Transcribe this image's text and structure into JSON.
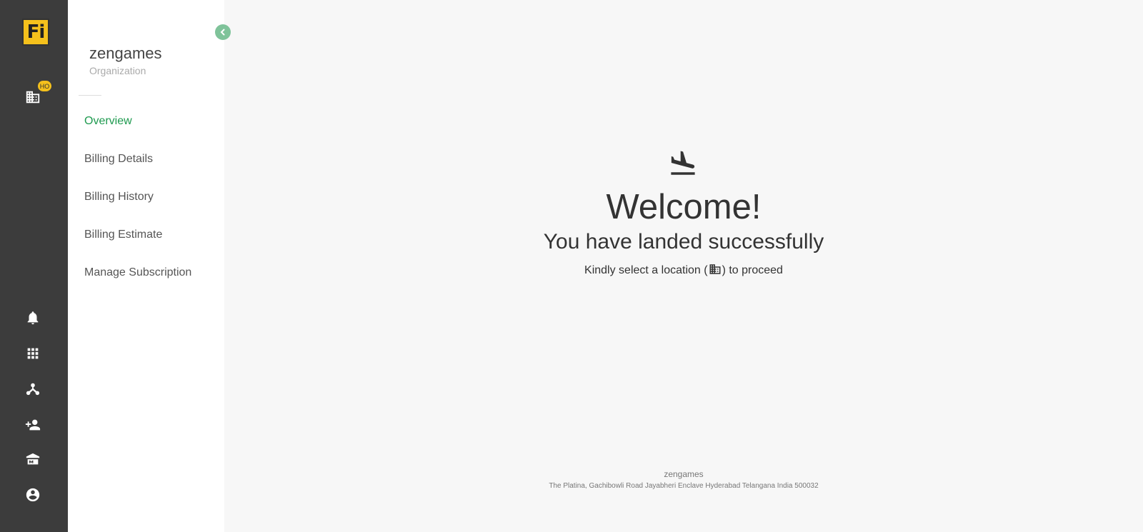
{
  "brand": {
    "logo_text": "Fi",
    "accent": "#f5c11c"
  },
  "rail": {
    "badge": "HO",
    "icons": [
      "building-icon",
      "bell-icon",
      "apps-grid-icon",
      "hierarchy-icon",
      "add-person-icon",
      "bank-icon",
      "account-circle-icon"
    ]
  },
  "sidebar": {
    "org_name": "zengames",
    "org_sub": "Organization",
    "items": [
      {
        "label": "Overview",
        "active": true
      },
      {
        "label": "Billing Details"
      },
      {
        "label": "Billing History"
      },
      {
        "label": "Billing Estimate"
      },
      {
        "label": "Manage Subscription"
      }
    ]
  },
  "main": {
    "welcome": "Welcome!",
    "subtitle": "You have landed successfully",
    "instruction_before": "Kindly select a location (",
    "instruction_after": ") to proceed"
  },
  "footer": {
    "name": "zengames",
    "address": "The Platina, Gachibowli Road Jayabheri Enclave Hyderabad Telangana India 500032"
  },
  "colors": {
    "active": "#1e9a4f",
    "rail": "#3c3c3c",
    "collapse": "#7fc39a"
  }
}
